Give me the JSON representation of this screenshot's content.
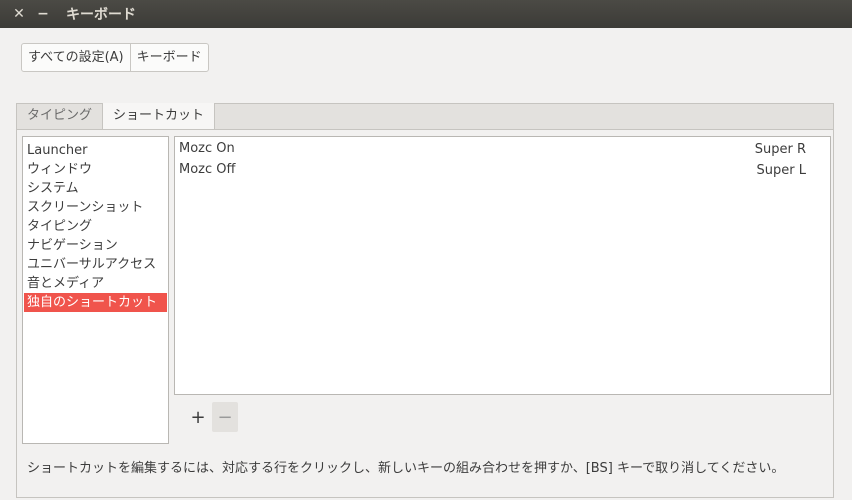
{
  "window": {
    "title": "キーボード",
    "close_glyph": "✕",
    "minimize_glyph": "−"
  },
  "breadcrumb": {
    "all_settings": "すべての設定(A)",
    "current": "キーボード"
  },
  "tabs": [
    {
      "label": "タイピング",
      "active": false
    },
    {
      "label": "ショートカット",
      "active": true
    }
  ],
  "categories": [
    "Launcher",
    "ウィンドウ",
    "システム",
    "スクリーンショット",
    "タイピング",
    "ナビゲーション",
    "ユニバーサルアクセス",
    "音とメディア",
    "独自のショートカット"
  ],
  "selected_category": "独自のショートカット",
  "shortcuts": [
    {
      "name": "Mozc On",
      "key": "Super R"
    },
    {
      "name": "Mozc Off",
      "key": "Super L"
    }
  ],
  "buttons": {
    "add": "+",
    "remove": "−"
  },
  "hint": "ショートカットを編集するには、対応する行をクリックし、新しいキーの組み合わせを押すか、[BS] キーで取り消してください。",
  "colors": {
    "selection": "#f0544c",
    "titlebar": "#3c3b37"
  }
}
